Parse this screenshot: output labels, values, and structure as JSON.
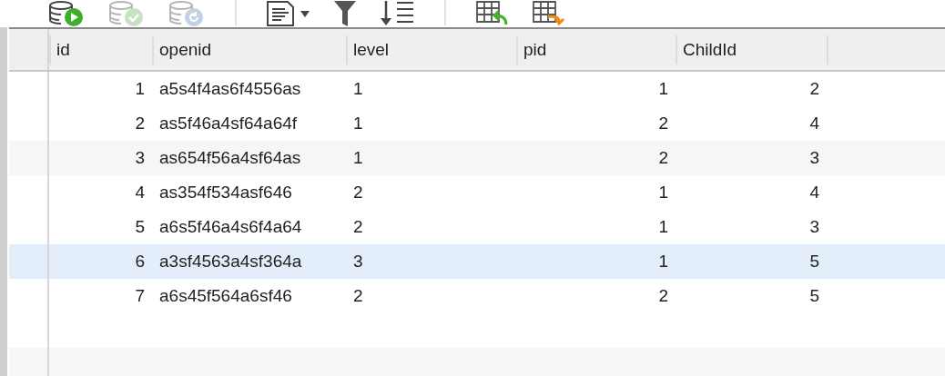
{
  "toolbar": {
    "buttons": [
      {
        "kind": "db-run",
        "disabled": false
      },
      {
        "kind": "db-check",
        "disabled": true
      },
      {
        "kind": "db-revert",
        "disabled": true
      },
      {
        "kind": "separator"
      },
      {
        "kind": "document",
        "disabled": false
      },
      {
        "kind": "filter",
        "disabled": false
      },
      {
        "kind": "sort",
        "disabled": false
      },
      {
        "kind": "separator"
      },
      {
        "kind": "import",
        "disabled": false
      },
      {
        "kind": "export",
        "disabled": false
      }
    ]
  },
  "table": {
    "columns": [
      "id",
      "openid",
      "level",
      "pid",
      "ChildId"
    ],
    "rows": [
      {
        "cells": [
          "1",
          "a5s4f4as6f4556as",
          "1",
          "1",
          "2"
        ],
        "selected": false
      },
      {
        "cells": [
          "2",
          "as5f46a4sf64a64f",
          "1",
          "2",
          "4"
        ],
        "selected": false
      },
      {
        "cells": [
          "3",
          "as654f56a4sf64as",
          "1",
          "2",
          "3"
        ],
        "selected": false
      },
      {
        "cells": [
          "4",
          "as354f534asf646",
          "2",
          "1",
          "4"
        ],
        "selected": false
      },
      {
        "cells": [
          "5",
          "a6s5f46a4s6f4a64",
          "2",
          "1",
          "3"
        ],
        "selected": false
      },
      {
        "cells": [
          "6",
          "a3sf4563a4sf364a",
          "3",
          "1",
          "5"
        ],
        "selected": true
      },
      {
        "cells": [
          "7",
          "a6s45f564a6sf46",
          "2",
          "2",
          "5"
        ],
        "selected": false
      }
    ]
  }
}
